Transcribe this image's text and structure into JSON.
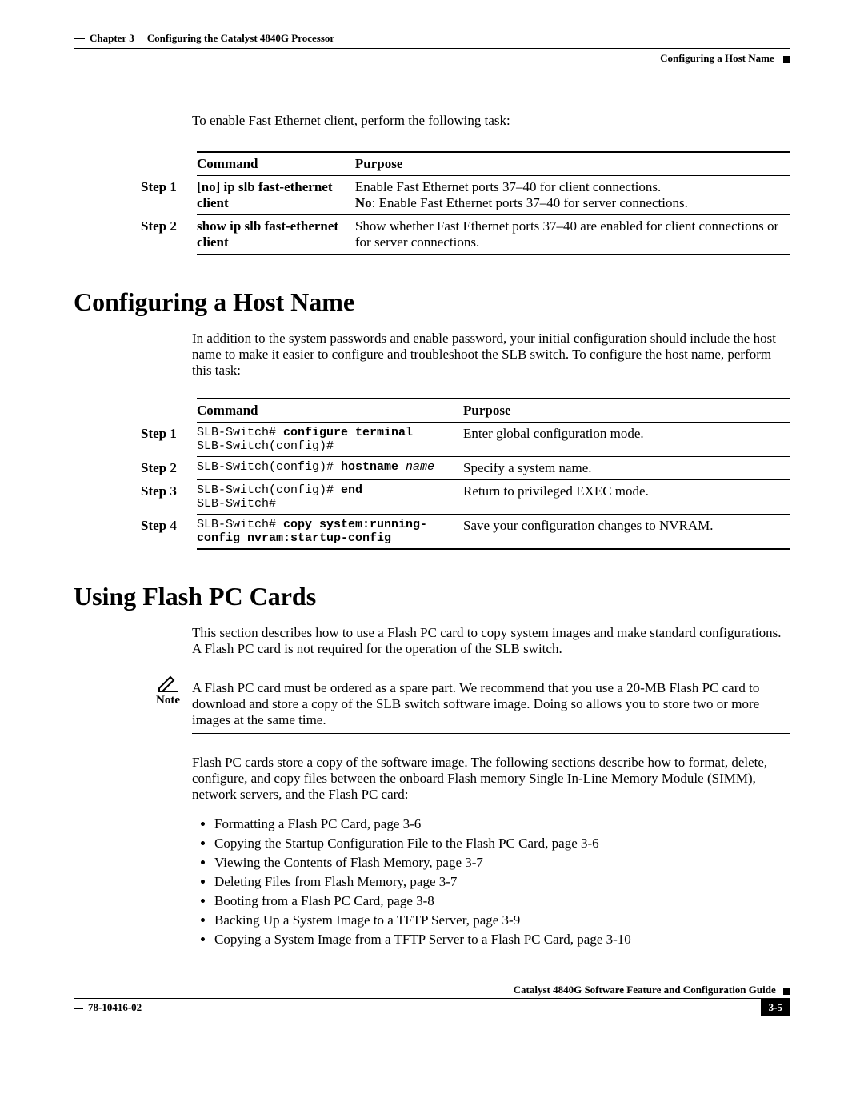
{
  "header": {
    "chapter_label": "Chapter 3",
    "chapter_title": "Configuring the Catalyst 4840G Processor",
    "section_right": "Configuring a Host Name"
  },
  "intro1": "To enable Fast Ethernet client, perform the following task:",
  "table1": {
    "head_command": "Command",
    "head_purpose": "Purpose",
    "rows": [
      {
        "step": "Step 1",
        "command": "[no] ip slb fast-ethernet client",
        "purpose1": "Enable Fast Ethernet ports 37–40 for client connections.",
        "purpose2_label": "No",
        "purpose2_text": ": Enable Fast Ethernet ports 37–40 for server connections."
      },
      {
        "step": "Step 2",
        "command": "show ip slb fast-ethernet client",
        "purpose": "Show whether Fast Ethernet ports 37–40 are enabled for client connections or for server connections."
      }
    ]
  },
  "section2": {
    "title": "Configuring a Host Name",
    "text": "In addition to the system passwords and enable password, your initial configuration should include the host name to make it easier to configure and troubleshoot the SLB switch. To configure the host name, perform this task:"
  },
  "table2": {
    "head_command": "Command",
    "head_purpose": "Purpose",
    "rows": [
      {
        "step": "Step 1",
        "prompt1": "SLB-Switch# ",
        "cmd1": "configure terminal",
        "prompt2": "SLB-Switch(config)#",
        "purpose": "Enter global configuration mode."
      },
      {
        "step": "Step 2",
        "prompt1": "SLB-Switch(config)# ",
        "cmd1": "hostname",
        "arg1": " name",
        "purpose": "Specify a system name."
      },
      {
        "step": "Step 3",
        "prompt1": "SLB-Switch(config)# ",
        "cmd1": "end",
        "prompt2": "SLB-Switch#",
        "purpose": "Return to privileged EXEC mode."
      },
      {
        "step": "Step 4",
        "prompt1": "SLB-Switch# ",
        "cmd1": "copy system:running-config nvram:startup-config",
        "purpose": "Save your configuration changes to NVRAM."
      }
    ]
  },
  "section3": {
    "title": "Using Flash PC Cards",
    "text1": "This section describes how to use a Flash PC card to copy system images and make standard configurations. A Flash PC card is not required for the operation of the SLB switch.",
    "note_label": "Note",
    "note_text": "A Flash PC card must be ordered as a spare part. We recommend that you use a 20-MB Flash PC card to download and store a copy of the SLB switch software image. Doing so allows you to store two or more images at the same time.",
    "text2": "Flash PC cards store a copy of the software image. The following sections describe how to format, delete, configure, and copy files between the onboard Flash memory Single In-Line Memory Module (SIMM), network servers, and the Flash PC card:",
    "bullets": [
      "Formatting a Flash PC Card, page 3-6",
      "Copying the Startup Configuration File to the Flash PC Card, page 3-6",
      "Viewing the Contents of Flash Memory, page 3-7",
      "Deleting Files from Flash Memory, page 3-7",
      "Booting from a Flash PC Card, page 3-8",
      "Backing Up a System Image to a TFTP Server, page 3-9",
      "Copying a System Image from a TFTP Server to a Flash PC Card, page 3-10"
    ]
  },
  "footer": {
    "guide": "Catalyst 4840G Software Feature and Configuration Guide",
    "docnum": "78-10416-02",
    "pagenum": "3-5"
  }
}
